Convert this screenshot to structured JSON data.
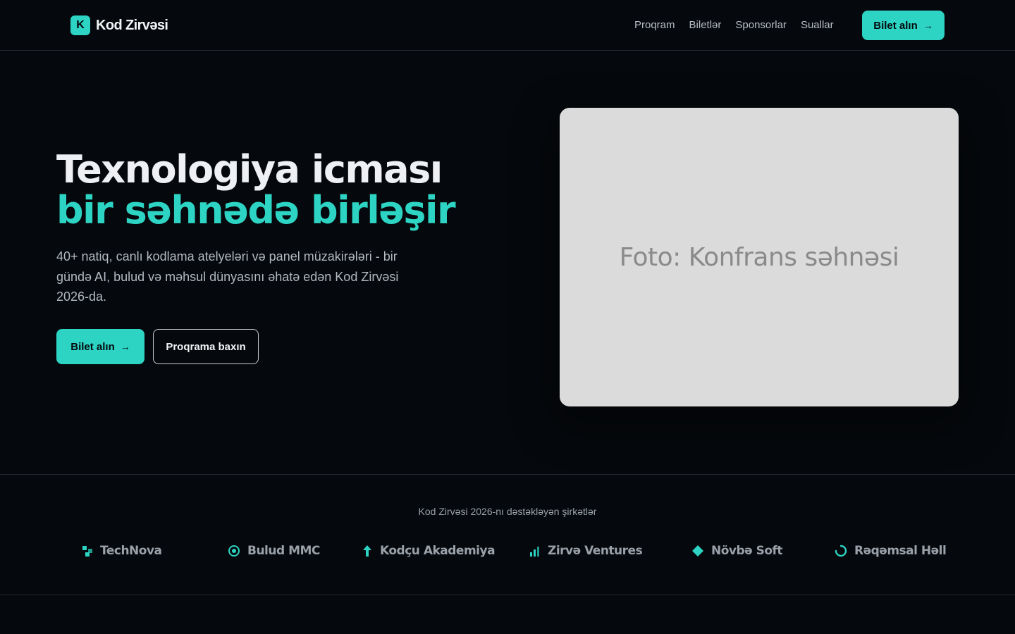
{
  "brand": {
    "logo_letter": "K",
    "name": "Kod Zirvəsi",
    "accent": "#2dd4c4"
  },
  "nav": {
    "items": [
      "Proqram",
      "Biletlər",
      "Sponsorlar",
      "Suallar"
    ]
  },
  "header_cta": {
    "label": "Bilet alın",
    "icon": "arrow-right-icon"
  },
  "hero": {
    "title_line1": "Texnologiya icması",
    "title_line2": "bir səhnədə birləşir",
    "description": "40+ natiq, canlı kodlama atelyeləri və panel müzakirələri - bir gündə AI, bulud və məhsul dünyasını əhatə edən Kod Zirvəsi 2026-da.",
    "primary_button": "Bilet alın",
    "secondary_button": "Proqrama baxın",
    "image_placeholder": "Foto: Konfrans səhnəsi"
  },
  "sponsors": {
    "title": "Kod Zirvəsi 2026-nı dəstəkləyən şirkətlər",
    "items": [
      {
        "name": "TechNova",
        "icon": "squares-icon"
      },
      {
        "name": "Bulud MMC",
        "icon": "target-icon"
      },
      {
        "name": "Kodçu Akademiya",
        "icon": "arrow-up-icon"
      },
      {
        "name": "Zirvə Ventures",
        "icon": "bar-chart-icon"
      },
      {
        "name": "Növbə Soft",
        "icon": "diamond-icon"
      },
      {
        "name": "Rəqəmsal Həll",
        "icon": "spinner-icon"
      }
    ]
  }
}
